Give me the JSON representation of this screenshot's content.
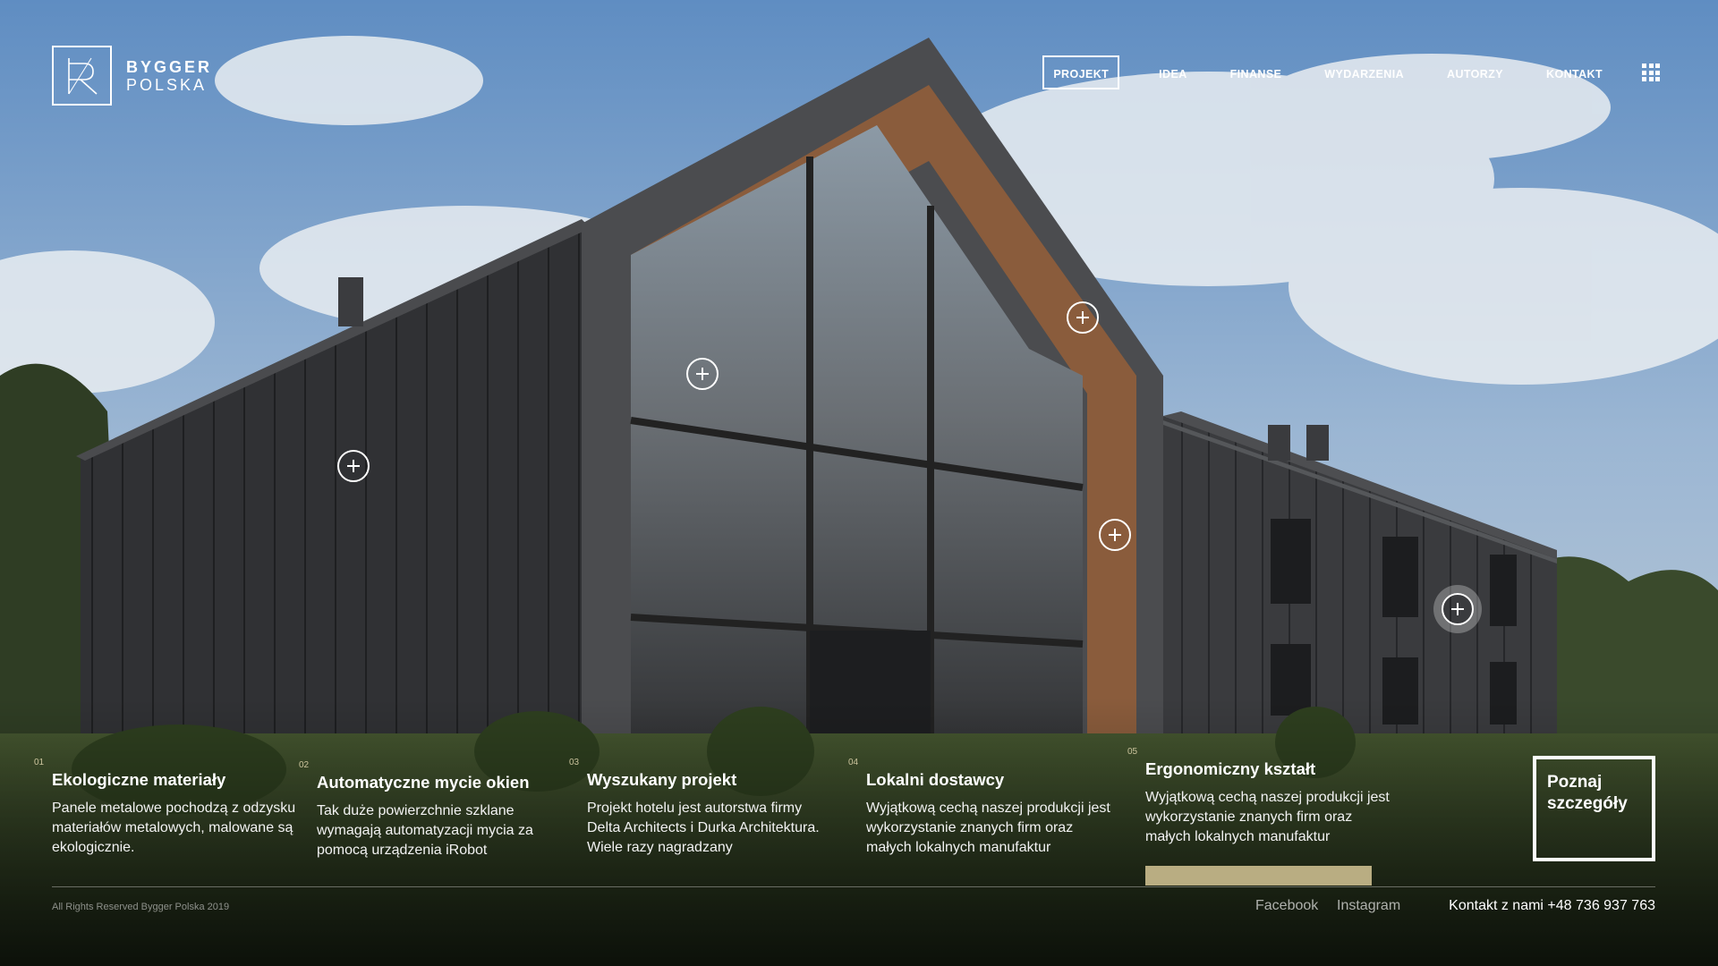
{
  "brand": {
    "name_line1": "BYGGER",
    "name_line2": "POLSKA",
    "logo_icon": "br-monogram-icon"
  },
  "nav": {
    "items": [
      {
        "label": "PROJEKT",
        "active": true
      },
      {
        "label": "IDEA",
        "active": false
      },
      {
        "label": "FINANSE",
        "active": false
      },
      {
        "label": "WYDARZENIA",
        "active": false
      },
      {
        "label": "AUTORZY",
        "active": false
      },
      {
        "label": "KONTAKT",
        "active": false
      }
    ],
    "menu_icon": "grid-menu-icon"
  },
  "hotspots": {
    "icon": "plus-circle-icon",
    "count": 6
  },
  "features": [
    {
      "num": "01",
      "title": "Ekologiczne materiały",
      "desc": "Panele metalowe pochodzą z odzysku materiałów metalowych, malowane są ekologicznie."
    },
    {
      "num": "02",
      "title": "Automatyczne mycie okien",
      "desc": "Tak duże powierzchnie szklane wymagają automatyzacji mycia za pomocą urządzenia iRobot"
    },
    {
      "num": "03",
      "title": "Wyszukany projekt",
      "desc": "Projekt hotelu jest autorstwa firmy Delta Architects i Durka Architektura. Wiele razy nagradzany"
    },
    {
      "num": "04",
      "title": "Lokalni dostawcy",
      "desc": "Wyjątkową cechą naszej produkcji jest wykorzystanie znanych firm oraz małych lokalnych manufaktur"
    },
    {
      "num": "05",
      "title": "Ergonomiczny kształt",
      "desc": "Wyjątkową cechą naszej produkcji jest wykorzystanie znanych firm oraz małych lokalnych manufaktur"
    }
  ],
  "cta": {
    "line1": "Poznaj",
    "line2": "szczegóły"
  },
  "footer": {
    "copyright": "All Rights Reserved Bygger Polska 2019",
    "facebook": "Facebook",
    "instagram": "Instagram",
    "contact": "Kontakt z nami +48 736 937 763"
  },
  "colors": {
    "accent": "#b9ad82",
    "sky": "#6f97c6",
    "facade": "#2f3033",
    "wood": "#8a5c3c",
    "grass": "#3e4f2c"
  }
}
